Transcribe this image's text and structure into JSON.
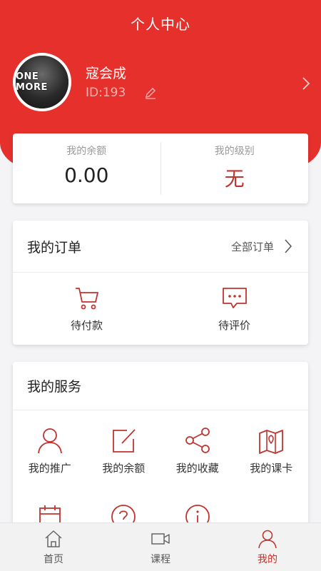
{
  "header": {
    "title": "个人中心"
  },
  "profile": {
    "avatar_text": "ONE MORE",
    "name": "寇会成",
    "id": "ID:193"
  },
  "stats": {
    "balance_label": "我的余额",
    "balance_value": "0.00",
    "level_label": "我的级别",
    "level_value": "无"
  },
  "orders": {
    "title": "我的订单",
    "all_label": "全部订单",
    "items": [
      {
        "label": "待付款",
        "icon": "cart-icon"
      },
      {
        "label": "待评价",
        "icon": "comment-icon"
      }
    ]
  },
  "services": {
    "title": "我的服务",
    "items": [
      {
        "label": "我的推广",
        "icon": "user-icon"
      },
      {
        "label": "我的余额",
        "icon": "edit-square-icon"
      },
      {
        "label": "我的收藏",
        "icon": "share-icon"
      },
      {
        "label": "我的课卡",
        "icon": "map-icon"
      }
    ],
    "partial_icons": [
      "calendar-icon",
      "question-icon",
      "info-icon"
    ]
  },
  "tabbar": {
    "items": [
      {
        "label": "首页",
        "icon": "home-icon"
      },
      {
        "label": "课程",
        "icon": "video-icon"
      },
      {
        "label": "我的",
        "icon": "person-icon"
      }
    ],
    "active_index": 2
  },
  "colors": {
    "brand": "#e5302c",
    "accent_text": "#c0342f",
    "page_bg": "#f4f4f6"
  }
}
